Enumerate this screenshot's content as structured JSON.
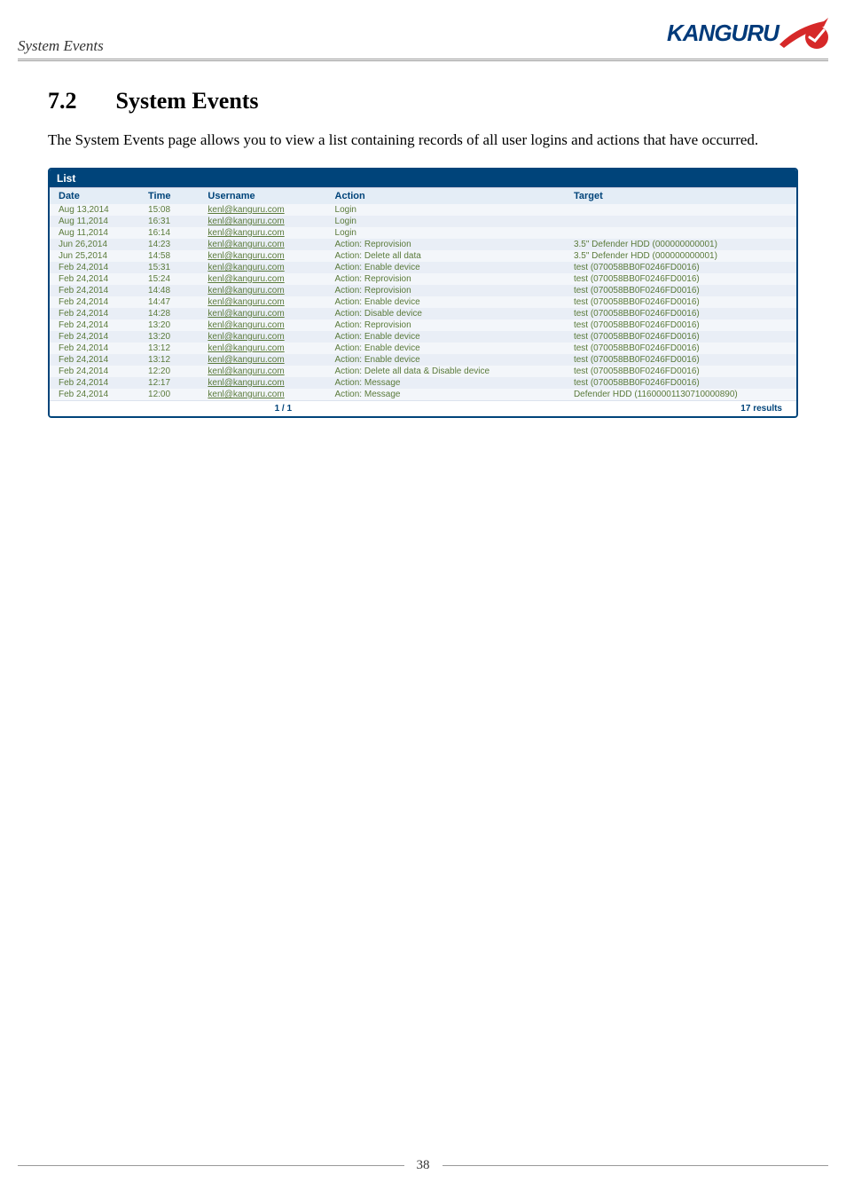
{
  "header": {
    "title": "System Events"
  },
  "logo": {
    "text": "KANGURU"
  },
  "section": {
    "number": "7.2",
    "title": "System Events"
  },
  "body": "The System Events page allows you to view a list containing records of all user logins and actions that have occurred.",
  "list": {
    "title": "List",
    "columns": {
      "date": "Date",
      "time": "Time",
      "username": "Username",
      "action": "Action",
      "target": "Target"
    },
    "rows": [
      {
        "date": "Aug 13,2014",
        "time": "15:08",
        "user": "kenl@kanguru.com",
        "action": "Login",
        "target": ""
      },
      {
        "date": "Aug 11,2014",
        "time": "16:31",
        "user": "kenl@kanguru.com",
        "action": "Login",
        "target": ""
      },
      {
        "date": "Aug 11,2014",
        "time": "16:14",
        "user": "kenl@kanguru.com",
        "action": "Login",
        "target": ""
      },
      {
        "date": "Jun 26,2014",
        "time": "14:23",
        "user": "kenl@kanguru.com",
        "action": "Action: Reprovision",
        "target": "3.5\" Defender HDD (000000000001)"
      },
      {
        "date": "Jun 25,2014",
        "time": "14:58",
        "user": "kenl@kanguru.com",
        "action": "Action: Delete all data",
        "target": "3.5\" Defender HDD (000000000001)"
      },
      {
        "date": "Feb 24,2014",
        "time": "15:31",
        "user": "kenl@kanguru.com",
        "action": "Action: Enable device",
        "target": "test (070058BB0F0246FD0016)"
      },
      {
        "date": "Feb 24,2014",
        "time": "15:24",
        "user": "kenl@kanguru.com",
        "action": "Action: Reprovision",
        "target": "test (070058BB0F0246FD0016)"
      },
      {
        "date": "Feb 24,2014",
        "time": "14:48",
        "user": "kenl@kanguru.com",
        "action": "Action: Reprovision",
        "target": "test (070058BB0F0246FD0016)"
      },
      {
        "date": "Feb 24,2014",
        "time": "14:47",
        "user": "kenl@kanguru.com",
        "action": "Action: Enable device",
        "target": "test (070058BB0F0246FD0016)"
      },
      {
        "date": "Feb 24,2014",
        "time": "14:28",
        "user": "kenl@kanguru.com",
        "action": "Action: Disable device",
        "target": "test (070058BB0F0246FD0016)"
      },
      {
        "date": "Feb 24,2014",
        "time": "13:20",
        "user": "kenl@kanguru.com",
        "action": "Action: Reprovision",
        "target": "test (070058BB0F0246FD0016)"
      },
      {
        "date": "Feb 24,2014",
        "time": "13:20",
        "user": "kenl@kanguru.com",
        "action": "Action: Enable device",
        "target": "test (070058BB0F0246FD0016)"
      },
      {
        "date": "Feb 24,2014",
        "time": "13:12",
        "user": "kenl@kanguru.com",
        "action": "Action: Enable device",
        "target": "test (070058BB0F0246FD0016)"
      },
      {
        "date": "Feb 24,2014",
        "time": "13:12",
        "user": "kenl@kanguru.com",
        "action": "Action: Enable device",
        "target": "test (070058BB0F0246FD0016)"
      },
      {
        "date": "Feb 24,2014",
        "time": "12:20",
        "user": "kenl@kanguru.com",
        "action": "Action: Delete all data & Disable device",
        "target": "test (070058BB0F0246FD0016)"
      },
      {
        "date": "Feb 24,2014",
        "time": "12:17",
        "user": "kenl@kanguru.com",
        "action": "Action: Message",
        "target": "test (070058BB0F0246FD0016)"
      },
      {
        "date": "Feb 24,2014",
        "time": "12:00",
        "user": "kenl@kanguru.com",
        "action": "Action: Message",
        "target": "Defender HDD (11600001130710000890)"
      }
    ],
    "pager": "1 / 1",
    "results": "17 results"
  },
  "page_number": "38"
}
